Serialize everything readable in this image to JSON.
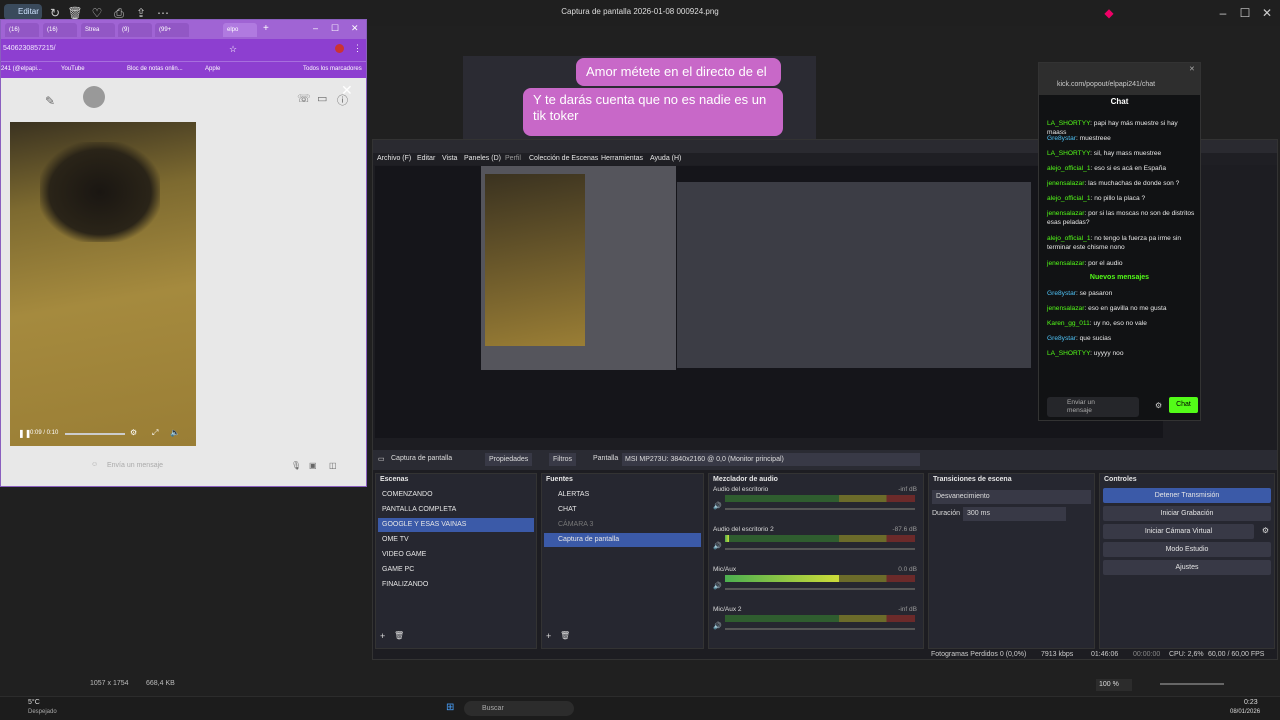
{
  "viewer": {
    "title": "Captura de pantalla 2026-01-08 000924.png",
    "edit_label": "Editar",
    "image_size": "1057 x 1754",
    "file_size": "668,4 KB",
    "zoom": "100 %"
  },
  "browser": {
    "tabs": [
      "(16)",
      "(16)",
      "Strea",
      "(9)",
      "(99+",
      "elpo"
    ],
    "address": "5406230857215/",
    "bookmarks": [
      "241 (@elpapi...",
      "YouTube",
      "Bloc de notas onlin...",
      "Apple",
      "Todos los marcadores"
    ],
    "video_time": "0:09 / 0:10",
    "message_placeholder": "Envía un mensaje"
  },
  "phone_chat": {
    "bubble1": "Amor métete en el directo de el",
    "bubble2": "Y te darás cuenta que no es nadie es un tik toker"
  },
  "obs": {
    "menu": [
      "Archivo (F)",
      "Editar",
      "Vista",
      "Paneles (D)",
      "Perfil",
      "Colección de Escenas",
      "Herramientas",
      "Ayuda (H)"
    ],
    "source_label": "Captura de pantalla",
    "props_label": "Propiedades",
    "filters_label": "Filtros",
    "screen_label": "Pantalla",
    "screen_value": "MSI MP273U: 3840x2160 @ 0,0 (Monitor principal)",
    "scenes_title": "Escenas",
    "scenes": [
      "COMENZANDO",
      "PANTALLA COMPLETA",
      "GOOGLE Y ESAS VAINAS",
      "OME TV",
      "VIDEO GAME",
      "GAME PC",
      "FINALIZANDO"
    ],
    "sources_title": "Fuentes",
    "sources": [
      "ALERTAS",
      "CHAT",
      "CÁMARA 3",
      "Captura de pantalla"
    ],
    "mixer_title": "Mezclador de audio",
    "mixer": [
      {
        "name": "Audio del escritorio",
        "db": "-inf dB",
        "level": 0
      },
      {
        "name": "Audio del escritorio 2",
        "db": "-87.6 dB",
        "level": 0.02
      },
      {
        "name": "Mic/Aux",
        "db": "0.0 dB",
        "level": 0.6
      },
      {
        "name": "Mic/Aux 2",
        "db": "-inf dB",
        "level": 0
      }
    ],
    "transitions_title": "Transiciones de escena",
    "transition": "Desvanecimiento",
    "duration_label": "Duración",
    "duration_value": "300 ms",
    "controls_title": "Controles",
    "controls": [
      "Detener Transmisión",
      "Iniciar Grabación",
      "Iniciar Cámara Virtual",
      "Modo Estudio",
      "Ajustes"
    ],
    "status": {
      "frames": "Fotogramas Perdidos 0 (0,0%)",
      "kbps": "7913 kbps",
      "live_time": "01:46:06",
      "rec_time": "00:00:00",
      "cpu": "CPU: 2,6%",
      "fps": "60,00 / 60,00 FPS"
    }
  },
  "kick": {
    "url": "kick.com/popout/elpapi241/chat",
    "title": "Chat",
    "messages": [
      {
        "user": "LA_SHORTYY",
        "text": "papi hay más muestre si hay maass",
        "c": "u1"
      },
      {
        "user": "Gre8ystar",
        "text": "muestreee",
        "c": "u2"
      },
      {
        "user": "LA_SHORTYY",
        "text": "sil, hay mass muestree",
        "c": "u1"
      },
      {
        "user": "alejo_official_1",
        "text": "eso si es acá en España",
        "c": "u3"
      },
      {
        "user": "jenensalazar",
        "text": "las muchachas de donde son ?",
        "c": "u3"
      },
      {
        "user": "alejo_official_1",
        "text": "no pillo la placa ?",
        "c": "u3"
      },
      {
        "user": "jenensalazar",
        "text": "por si las moscas no son de distritos esas peladas?",
        "c": "u3"
      },
      {
        "user": "alejo_official_1",
        "text": "no tengo la fuerza pa irme sin terminar este chisme nono",
        "c": "u3"
      },
      {
        "user": "jenensalazar",
        "text": "por el audio",
        "c": "u3"
      },
      {
        "user": "Gre8ystar",
        "text": "se pasaron",
        "c": "u2"
      },
      {
        "user": "jenensalazar",
        "text": "eso en gavilla no me gusta",
        "c": "u3"
      },
      {
        "user": "Karen_gg_011",
        "text": "uy no, eso no vale",
        "c": "u3"
      },
      {
        "user": "Gre8ystar",
        "text": "que sucias",
        "c": "u2"
      },
      {
        "user": "LA_SHORTYY",
        "text": "uyyyy noo",
        "c": "u1"
      }
    ],
    "new_messages": "Nuevos mensajes",
    "input_placeholder": "Enviar un mensaje",
    "send_label": "Chat"
  },
  "taskbar": {
    "search": "Buscar",
    "weather_temp": "5°C",
    "weather_desc": "Despejado",
    "time": "0:23",
    "date": "08/01/2026"
  }
}
